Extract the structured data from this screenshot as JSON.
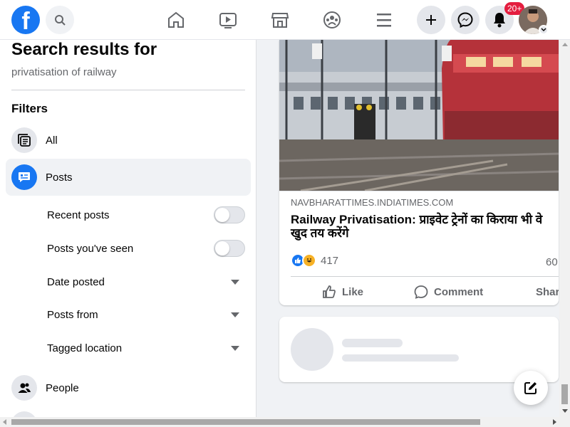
{
  "topbar": {
    "logo_letter": "f",
    "notifications_badge": "20+",
    "icons": [
      "facebook-logo",
      "search-icon",
      "home-icon",
      "watch-icon",
      "marketplace-icon",
      "groups-icon",
      "menu-icon",
      "create-icon",
      "messenger-icon",
      "notifications-icon",
      "account-avatar"
    ]
  },
  "sidebar": {
    "title": "Search results for",
    "query": "privatisation of railway",
    "filters_heading": "Filters",
    "items": [
      {
        "label": "All",
        "icon": "all-results-icon",
        "active": false
      },
      {
        "label": "Posts",
        "icon": "posts-icon",
        "active": true
      },
      {
        "label": "People",
        "icon": "people-icon",
        "active": false
      }
    ],
    "post_filters": [
      {
        "label": "Recent posts",
        "control": "toggle",
        "on": false
      },
      {
        "label": "Posts you've seen",
        "control": "toggle",
        "on": false
      },
      {
        "label": "Date posted",
        "control": "dropdown"
      },
      {
        "label": "Posts from",
        "control": "dropdown"
      },
      {
        "label": "Tagged location",
        "control": "dropdown"
      }
    ]
  },
  "post": {
    "link_domain": "NAVBHARATTIMES.INDIATIMES.COM",
    "headline": "Railway Privatisation: प्राइवेट ट्रेनों का किराया भी वे खुद तय करेंगे",
    "reaction_count": "417",
    "comment_count": "60",
    "actions": {
      "like": "Like",
      "comment": "Comment",
      "share": "Share"
    }
  },
  "colors": {
    "brand": "#1877f2",
    "badge": "#e41e3f",
    "muted_text": "#65676b"
  }
}
